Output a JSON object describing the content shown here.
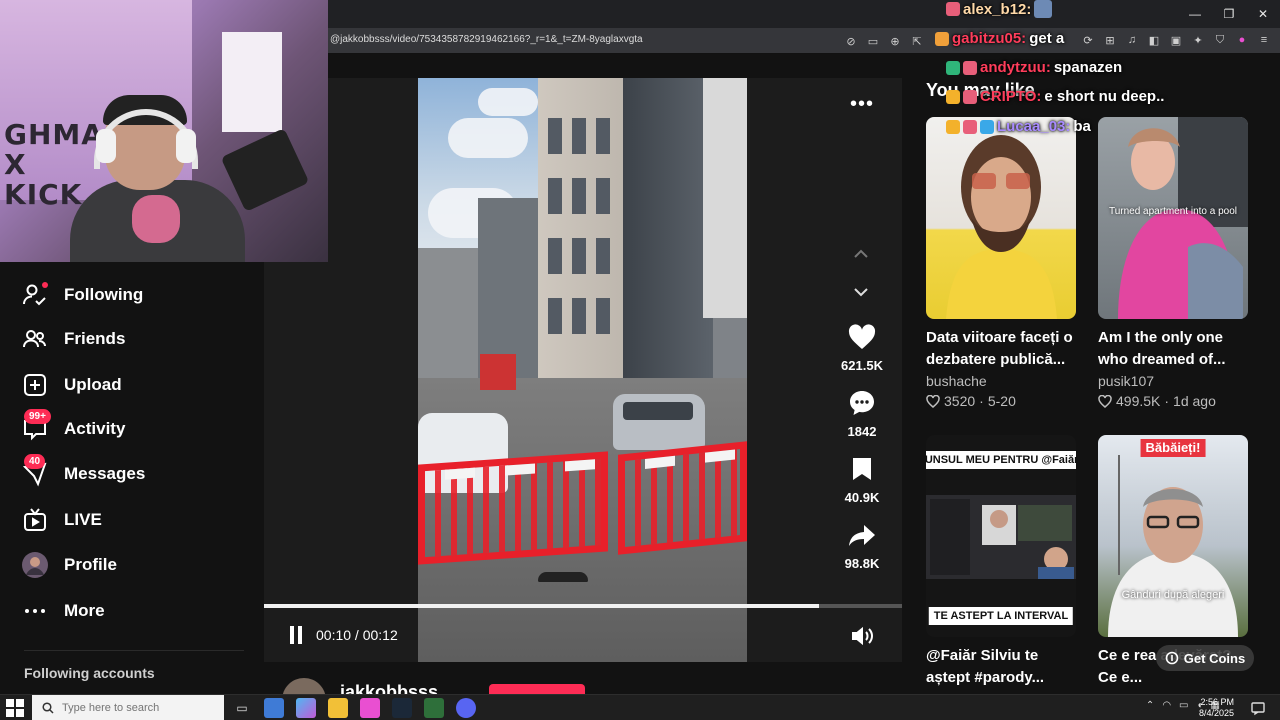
{
  "browser": {
    "url": "@jakkobbsss/video/7534358782919462166?_r=1&_t=ZM-8yaglaxvgta"
  },
  "sidebar": {
    "items": [
      {
        "label": "Following",
        "icon": "following-icon",
        "badge": ""
      },
      {
        "label": "Friends",
        "icon": "friends-icon",
        "badge": ""
      },
      {
        "label": "Upload",
        "icon": "upload-icon",
        "badge": ""
      },
      {
        "label": "Activity",
        "icon": "activity-icon",
        "badge": "99+"
      },
      {
        "label": "Messages",
        "icon": "messages-icon",
        "badge": "40"
      },
      {
        "label": "LIVE",
        "icon": "live-icon",
        "badge": ""
      },
      {
        "label": "Profile",
        "icon": "profile-avatar",
        "badge": ""
      },
      {
        "label": "More",
        "icon": "more-icon",
        "badge": ""
      }
    ],
    "following_accounts": "Following accounts"
  },
  "webcam": {
    "art_text": "GHMAN\nX\nKICK"
  },
  "player": {
    "likes": "621.5K",
    "comments": "1842",
    "saves": "40.9K",
    "shares": "98.8K",
    "time": "00:10 / 00:12",
    "progress_fraction": 0.87,
    "author": "jakkobbsss"
  },
  "recommendations": {
    "heading": "You may like",
    "cards": [
      {
        "title": "Data viitoare faceți o dezbatere publică...",
        "author": "bushache",
        "likes": "3520",
        "date": "5-20",
        "caption": ""
      },
      {
        "title": "Am I the only one who dreamed of...",
        "author": "pusik107",
        "likes": "499.5K",
        "date": "1d ago",
        "caption": "Turned apartment into a pool"
      },
      {
        "title": "@Faiăr Silviu te aștept #parody...",
        "author": "",
        "likes": "",
        "date": "",
        "caption_top": "RASPUNSUL MEU PENTRU @FaiărSilviu",
        "caption_bottom": "TE ASTEPT LA INTERVAL"
      },
      {
        "title": "Ce e rea adevărat? Ce e...",
        "author": "",
        "likes": "",
        "date": "",
        "caption_top": "Băbăieți!",
        "caption_bottom": "Gânduri după alegeri"
      }
    ],
    "get_coins": "Get Coins"
  },
  "chat": [
    {
      "user": "alex_b12:",
      "msg": ""
    },
    {
      "user": "gabitzu05:",
      "msg": "get a"
    },
    {
      "user": "andytzuu:",
      "msg": "spanazen"
    },
    {
      "user": "CRIPTO:",
      "msg": "e short nu deep.."
    },
    {
      "user": "Lucaa_03:",
      "msg": "ba"
    }
  ],
  "taskbar": {
    "search_placeholder": "Type here to search",
    "time": "2:56 PM",
    "date": "8/4/2025"
  },
  "colors": {
    "accent": "#fe2c55",
    "background": "#121212"
  }
}
